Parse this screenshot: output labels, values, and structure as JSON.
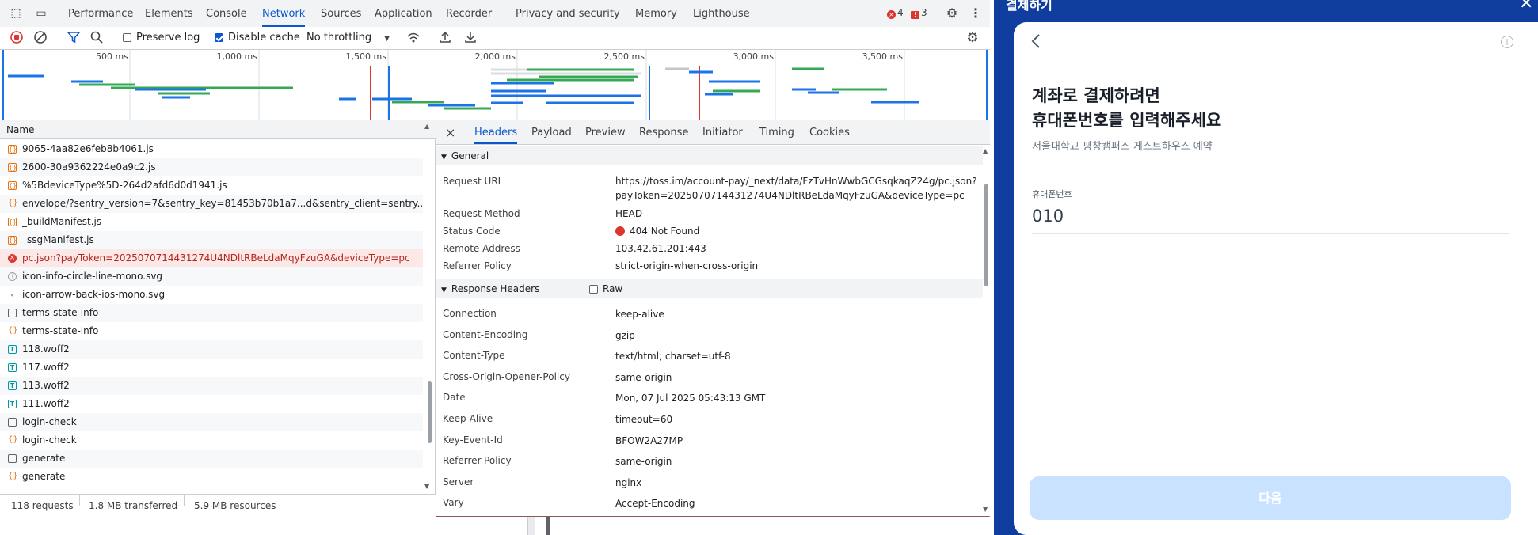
{
  "devtools": {
    "tabs": [
      "Performance",
      "Elements",
      "Console",
      "Network",
      "Sources",
      "Application",
      "Recorder",
      "Privacy and security",
      "Memory",
      "Lighthouse"
    ],
    "active_tab": "Network",
    "error_count": "4",
    "warning_count": "3",
    "toolbar": {
      "preserve_log": "Preserve log",
      "disable_cache": "Disable cache",
      "throttling": "No throttling"
    },
    "timeline_ticks": [
      "500 ms",
      "1,000 ms",
      "1,500 ms",
      "2,000 ms",
      "2,500 ms",
      "3,000 ms",
      "3,500 ms"
    ],
    "name_column": "Name",
    "requests": [
      {
        "name": "9065-4aa82e6feb8b4061.js",
        "type": "js"
      },
      {
        "name": "2600-30a9362224e0a9c2.js",
        "type": "js"
      },
      {
        "name": "%5BdeviceType%5D-264d2afd6d0d1941.js",
        "type": "js"
      },
      {
        "name": "envelope/?sentry_version=7&sentry_key=81453b70b1a7...d&sentry_client=sentry....",
        "type": "fetch"
      },
      {
        "name": "_buildManifest.js",
        "type": "js"
      },
      {
        "name": "_ssgManifest.js",
        "type": "js"
      },
      {
        "name": "pc.json?payToken=2025070714431274U4NDltRBeLdaMqyFzuGA&deviceType=pc",
        "type": "error"
      },
      {
        "name": "icon-info-circle-line-mono.svg",
        "type": "info"
      },
      {
        "name": "icon-arrow-back-ios-mono.svg",
        "type": "svg"
      },
      {
        "name": "terms-state-info",
        "type": "doc"
      },
      {
        "name": "terms-state-info",
        "type": "fetch"
      },
      {
        "name": "118.woff2",
        "type": "font"
      },
      {
        "name": "117.woff2",
        "type": "font"
      },
      {
        "name": "113.woff2",
        "type": "font"
      },
      {
        "name": "111.woff2",
        "type": "font"
      },
      {
        "name": "login-check",
        "type": "doc"
      },
      {
        "name": "login-check",
        "type": "fetch"
      },
      {
        "name": "generate",
        "type": "doc"
      },
      {
        "name": "generate",
        "type": "fetch"
      }
    ],
    "status": {
      "requests": "118 requests",
      "transferred": "1.8 MB transferred",
      "resources": "5.9 MB resources"
    },
    "detail_tabs": [
      "Headers",
      "Payload",
      "Preview",
      "Response",
      "Initiator",
      "Timing",
      "Cookies"
    ],
    "active_detail_tab": "Headers",
    "general": {
      "title": "General",
      "request_url_key": "Request URL",
      "request_url_line1": "https://toss.im/account-pay/_next/data/FzTvHnWwbGCGsqkaqZ24g/pc.json?",
      "request_url_line2": "payToken=2025070714431274U4NDltRBeLdaMqyFzuGA&deviceType=pc",
      "method_key": "Request Method",
      "method": "HEAD",
      "status_key": "Status Code",
      "status": "404 Not Found",
      "remote_key": "Remote Address",
      "remote": "103.42.61.201:443",
      "referrer_key": "Referrer Policy",
      "referrer": "strict-origin-when-cross-origin"
    },
    "response_headers": {
      "title": "Response Headers",
      "raw_label": "Raw",
      "rows": [
        {
          "k": "Connection",
          "v": "keep-alive"
        },
        {
          "k": "Content-Encoding",
          "v": "gzip"
        },
        {
          "k": "Content-Type",
          "v": "text/html; charset=utf-8"
        },
        {
          "k": "Cross-Origin-Opener-Policy",
          "v": "same-origin"
        },
        {
          "k": "Date",
          "v": "Mon, 07 Jul 2025 05:43:13 GMT"
        },
        {
          "k": "Keep-Alive",
          "v": "timeout=60"
        },
        {
          "k": "Key-Event-Id",
          "v": "BFOW2A27MP"
        },
        {
          "k": "Referrer-Policy",
          "v": "same-origin"
        },
        {
          "k": "Server",
          "v": "nginx"
        },
        {
          "k": "Vary",
          "v": "Accept-Encoding"
        }
      ]
    }
  },
  "payment": {
    "header_title": "결제하기",
    "heading_line1": "계좌로 결제하려면",
    "heading_line2": "휴대폰번호를 입력해주세요",
    "subtitle": "서울대학교 평창캠퍼스 게스트하우스 예약",
    "phone_label": "휴대폰번호",
    "phone_value": "010",
    "next_button": "다음"
  },
  "colors": {
    "accent": "#0b57d0",
    "error": "#dc362e",
    "toss_blue": "#0f3e9e",
    "button_disabled": "#c9e2ff"
  }
}
